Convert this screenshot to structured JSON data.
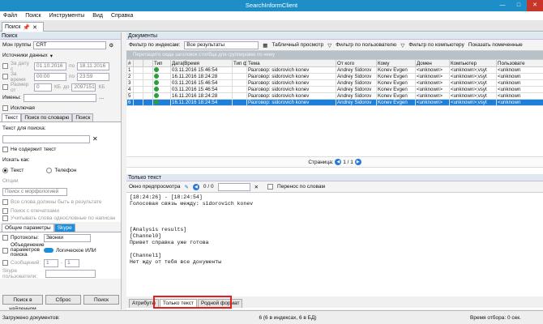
{
  "app": {
    "title": "SearchInformClient",
    "menu": [
      "Файл",
      "Поиск",
      "Инструменты",
      "Вид",
      "Справка"
    ],
    "doc_tab": "Поиск"
  },
  "left": {
    "section_search": "Поиск",
    "mon_group_label": "Мон группы",
    "mon_group_value": "CRT",
    "data_source_label": "Источники данных",
    "date_from_label": "За дату с",
    "date_from": "01.10.2016",
    "date_to_label": "по",
    "date_to": "18.11.2016",
    "time_label": "За время",
    "time_from": "00:00",
    "time_to": "23:59",
    "size_label": "Размер от",
    "size_from": "0",
    "size_from_unit": "КБ",
    "size_to_label": "до",
    "size_to": "2097151",
    "size_to_unit": "КБ",
    "names_label": "Имены:",
    "exclude_label": "Исключая",
    "tabs": [
      "Текст",
      "Поиск по словарю",
      "Поиск"
    ],
    "search_text_label": "Текст для поиска:",
    "not_contains": "Не содержит текст",
    "search_how": "Искать как:",
    "radio_text": "Текст",
    "radio_phone": "Телефон",
    "options_label": "Опции",
    "morph": "Поиск с морфологией",
    "all_words": "Все слова должны быть в результате",
    "phrase_search": "Поиск с опечатками",
    "exact_phrase": "Учитывать слова однословные по написан",
    "common_tab": "Общие параметры",
    "skype_tab": "Skype",
    "protocols_label": "Протоколы:",
    "protocols_value": "Звонки",
    "union_label": "Объединение параметров поиска",
    "logic_label": "Логическое ИЛИ",
    "messages_label": "Сообщений:",
    "msg_from": "1",
    "msg_to": "1",
    "skype_user_label": "Skype пользователи:",
    "search_in_found": "Поиск в найденном",
    "reset": "Сброс",
    "search": "Поиск"
  },
  "right": {
    "section_docs": "Документы",
    "filter_index_label": "Фильтр по индексам:",
    "filter_index_value": "Все результаты",
    "view_label": "Табличный просмотр",
    "filter_user": "Фильтр по пользователю",
    "filter_pc": "Фильтр по компьютеру",
    "show_marked": "Показать помеченные",
    "group_hint": "Перетащите сюда заголовок столбца для группировки по нему",
    "columns": [
      "#",
      "",
      "",
      "Тип",
      "Дата|Время",
      "Тип фа",
      "Тема",
      "От кого",
      "Кому",
      "Домен",
      "Компьютер",
      "Пользовате"
    ],
    "rows": [
      [
        "1",
        "",
        "",
        "",
        "03.11.2016 15:46:54",
        "",
        "Разговор: sidorovich konev",
        "Andrey Sidorov",
        "Konev Evgen",
        "<unknown>",
        "<unknown>;vsyt",
        "<unknown"
      ],
      [
        "2",
        "",
        "",
        "",
        "16.11.2016 18:24:28",
        "",
        "Разговор: sidorovich konev",
        "Andrey Sidorov",
        "Konev Evgen",
        "<unknown>",
        "<unknown>;vsyt",
        "<unknown"
      ],
      [
        "3",
        "",
        "",
        "",
        "03.11.2016 15:46:54",
        "",
        "Разговор: sidorovich konev",
        "Andrey Sidorov",
        "Konev Evgen",
        "<unknown>",
        "<unknown>;vsyt",
        "<unknown"
      ],
      [
        "4",
        "",
        "",
        "",
        "03.11.2016 15:46:54",
        "",
        "Разговор: sidorovich konev",
        "Andrey Sidorov",
        "Konev Evgen",
        "<unknown>",
        "<unknown>;vsyt",
        "<unknown"
      ],
      [
        "5",
        "",
        "",
        "",
        "16.11.2016 18:24:28",
        "",
        "Разговор: sidorovich konev",
        "Andrey Sidorov",
        "Konev Evgen",
        "<unknown>",
        "<unknown>;vsyt",
        "<unknown"
      ],
      [
        "6",
        "",
        "",
        "",
        "16.11.2016 18:24:54",
        "",
        "Разговор: sidorovich konev",
        "Andrey Sidorov",
        "Konev Evgen",
        "<unknown>",
        "<unknown>;vsyt",
        "<unknown"
      ]
    ],
    "page_label": "Страница:",
    "page_value": "1 / 1",
    "section_text": "Только текст",
    "preview_window": "Окно предпросмотра",
    "match_counter": "0 / 0",
    "wrap_words": "Перенос по словам",
    "preview_lines": [
      "[18:24:26] - [18:24:54]",
      "Голосовая связь между: sidorovich konev",
      "",
      "",
      "",
      "[Analysis results]",
      "[Channel0]",
      "Привет справка уже готова",
      "",
      "[Channel1]",
      "Нет жду от тебя все документы"
    ],
    "bottom_tabs": [
      "Атрибуты",
      "Только текст",
      "Родной формат"
    ]
  },
  "status": {
    "loaded": "Загружено документов:",
    "count": "6 (6 в индексах, 6 в БД)",
    "time": "Время отбора: 0 сек."
  }
}
